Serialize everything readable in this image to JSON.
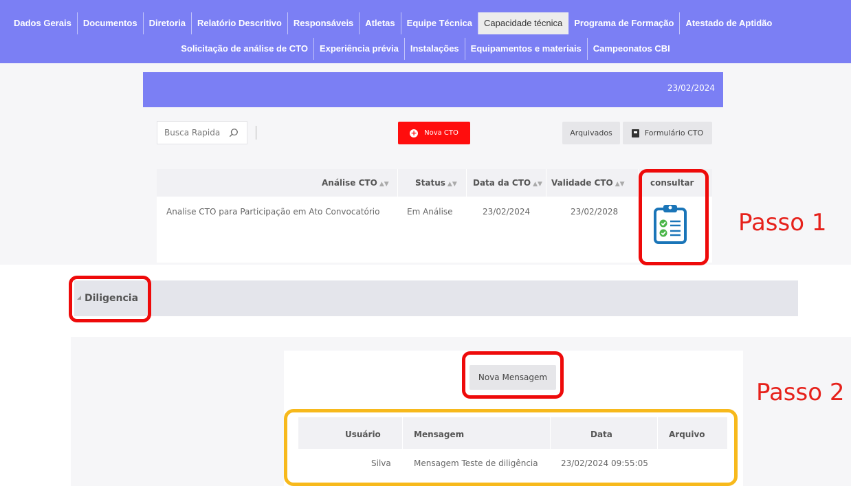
{
  "nav": {
    "row1": [
      "Dados Gerais",
      "Documentos",
      "Diretoria",
      "Relatório Descritivo",
      "Responsáveis",
      "Atletas",
      "Equipe Técnica",
      "Capacidade técnica",
      "Programa de Formação",
      "Atestado de Aptidão"
    ],
    "row2": [
      "Solicitação de análise de CTO",
      "Experiência prévia",
      "Instalações",
      "Equipamentos e materiais",
      "Campeonatos CBI"
    ],
    "active": "Capacidade técnica"
  },
  "card": {
    "date": "23/02/2024"
  },
  "toolbar": {
    "search_placeholder": "Busca Rapida",
    "nova_label": "Nova CTO",
    "arquivados_label": "Arquivados",
    "formulario_label": "Formulário CTO"
  },
  "cto_table": {
    "headers": {
      "analise": "Análise CTO",
      "status": "Status",
      "data": "Data da CTO",
      "validade": "Validade CTO",
      "consultar": "consultar"
    },
    "rows": [
      {
        "analise": "Analise CTO para Participação em Ato Convocatório",
        "status": "Em Análise",
        "data": "23/02/2024",
        "validade": "23/02/2028"
      }
    ]
  },
  "annotations": {
    "passo1": "Passo 1",
    "passo2": "Passo 2"
  },
  "diligencia": {
    "label": "Diligencia",
    "nova_mensagem_label": "Nova Mensagem",
    "headers": {
      "usuario": "Usuário",
      "mensagem": "Mensagem",
      "data": "Data",
      "arquivo": "Arquivo"
    },
    "rows": [
      {
        "usuario": "Silva",
        "mensagem": "Mensagem Teste de diligência",
        "data": "23/02/2024 09:55:05",
        "arquivo": ""
      }
    ]
  },
  "colors": {
    "accent": "#7b7ff4",
    "danger": "#ff0d0d",
    "annotation_red": "#ee0a0a",
    "annotation_yellow": "#f7b91c",
    "clipboard_blue": "#1a75b8",
    "check_green": "#4ab548"
  },
  "icons": [
    "search-icon",
    "plus-circle-icon",
    "book-icon",
    "clipboard-checklist-icon",
    "triangle-collapse-icon"
  ]
}
